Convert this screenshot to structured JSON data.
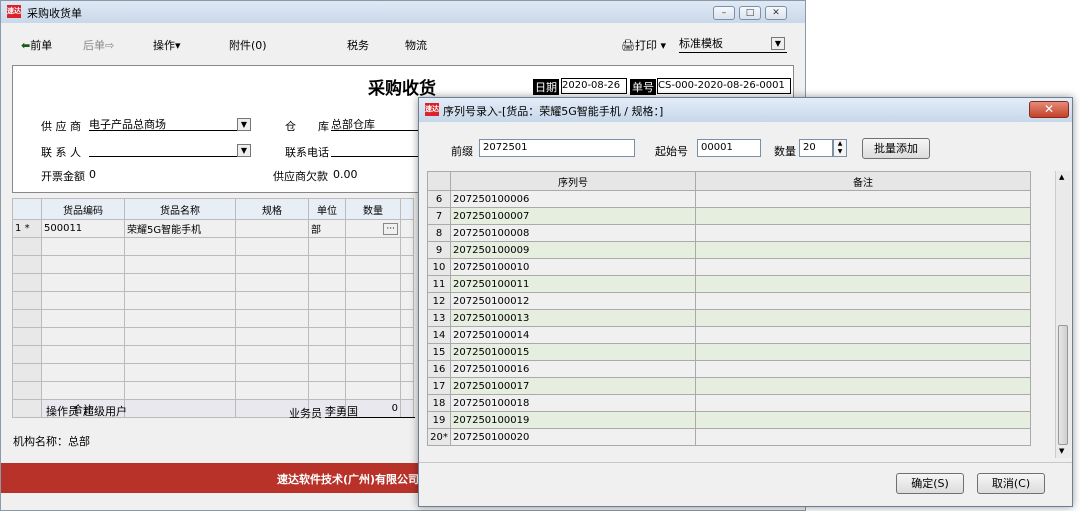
{
  "main": {
    "title": "采购收货单",
    "app_icon_text": "速达",
    "toolbar": {
      "prev": "前单",
      "next": "后单",
      "ops": "操作",
      "attach": "附件(0)",
      "tax": "税务",
      "logistics": "物流",
      "print": "打印",
      "template_value": "标准模板"
    },
    "form": {
      "heading": "采购收货",
      "date_label": "日期",
      "date_value": "2020-08-26",
      "no_label": "单号",
      "no_value": "CS-000-2020-08-26-0001",
      "supplier_label": "供 应 商",
      "supplier_value": "电子产品总商场",
      "warehouse_label": "仓　　库",
      "warehouse_value": "总部仓库",
      "contact_label": "联 系 人",
      "contact_value": "",
      "phone_label": "联系电话",
      "invoice_label": "开票金额",
      "invoice_value": "0",
      "debt_label": "供应商欠款",
      "debt_value": "0.00"
    },
    "grid": {
      "headers": [
        "货品编码",
        "货品名称",
        "规格",
        "单位",
        "数量"
      ],
      "row1": {
        "num": "1",
        "marker": "*",
        "code": "500011",
        "name": "荣耀5G智能手机",
        "spec": "",
        "unit": "部",
        "qty": ""
      },
      "total_label": "合计",
      "total_qty": "0"
    },
    "operator_label": "操作员",
    "operator_value": "超级用户",
    "salesman_label": "业务员",
    "salesman_value": "李勇国",
    "org": "机构名称：总部",
    "footer": "速达软件技术(广州)有限公司"
  },
  "dialog": {
    "title": "序列号录入-[货品：荣耀5G智能手机 / 规格：]",
    "prefix_label": "前缀",
    "prefix_value": "2072501",
    "start_label": "起始号",
    "start_value": "00001",
    "count_label": "数量",
    "count_value": "20",
    "batch_add": "批量添加",
    "col_serial": "序列号",
    "col_note": "备注",
    "rows": [
      {
        "n": "6",
        "s": "207250100006"
      },
      {
        "n": "7",
        "s": "207250100007"
      },
      {
        "n": "8",
        "s": "207250100008"
      },
      {
        "n": "9",
        "s": "207250100009"
      },
      {
        "n": "10",
        "s": "207250100010"
      },
      {
        "n": "11",
        "s": "207250100011"
      },
      {
        "n": "12",
        "s": "207250100012"
      },
      {
        "n": "13",
        "s": "207250100013"
      },
      {
        "n": "14",
        "s": "207250100014"
      },
      {
        "n": "15",
        "s": "207250100015"
      },
      {
        "n": "16",
        "s": "207250100016"
      },
      {
        "n": "17",
        "s": "207250100017"
      },
      {
        "n": "18",
        "s": "207250100018"
      },
      {
        "n": "19",
        "s": "207250100019"
      },
      {
        "n": "20*",
        "s": "207250100020"
      }
    ],
    "ok": "确定(S)",
    "cancel": "取消(C)"
  }
}
